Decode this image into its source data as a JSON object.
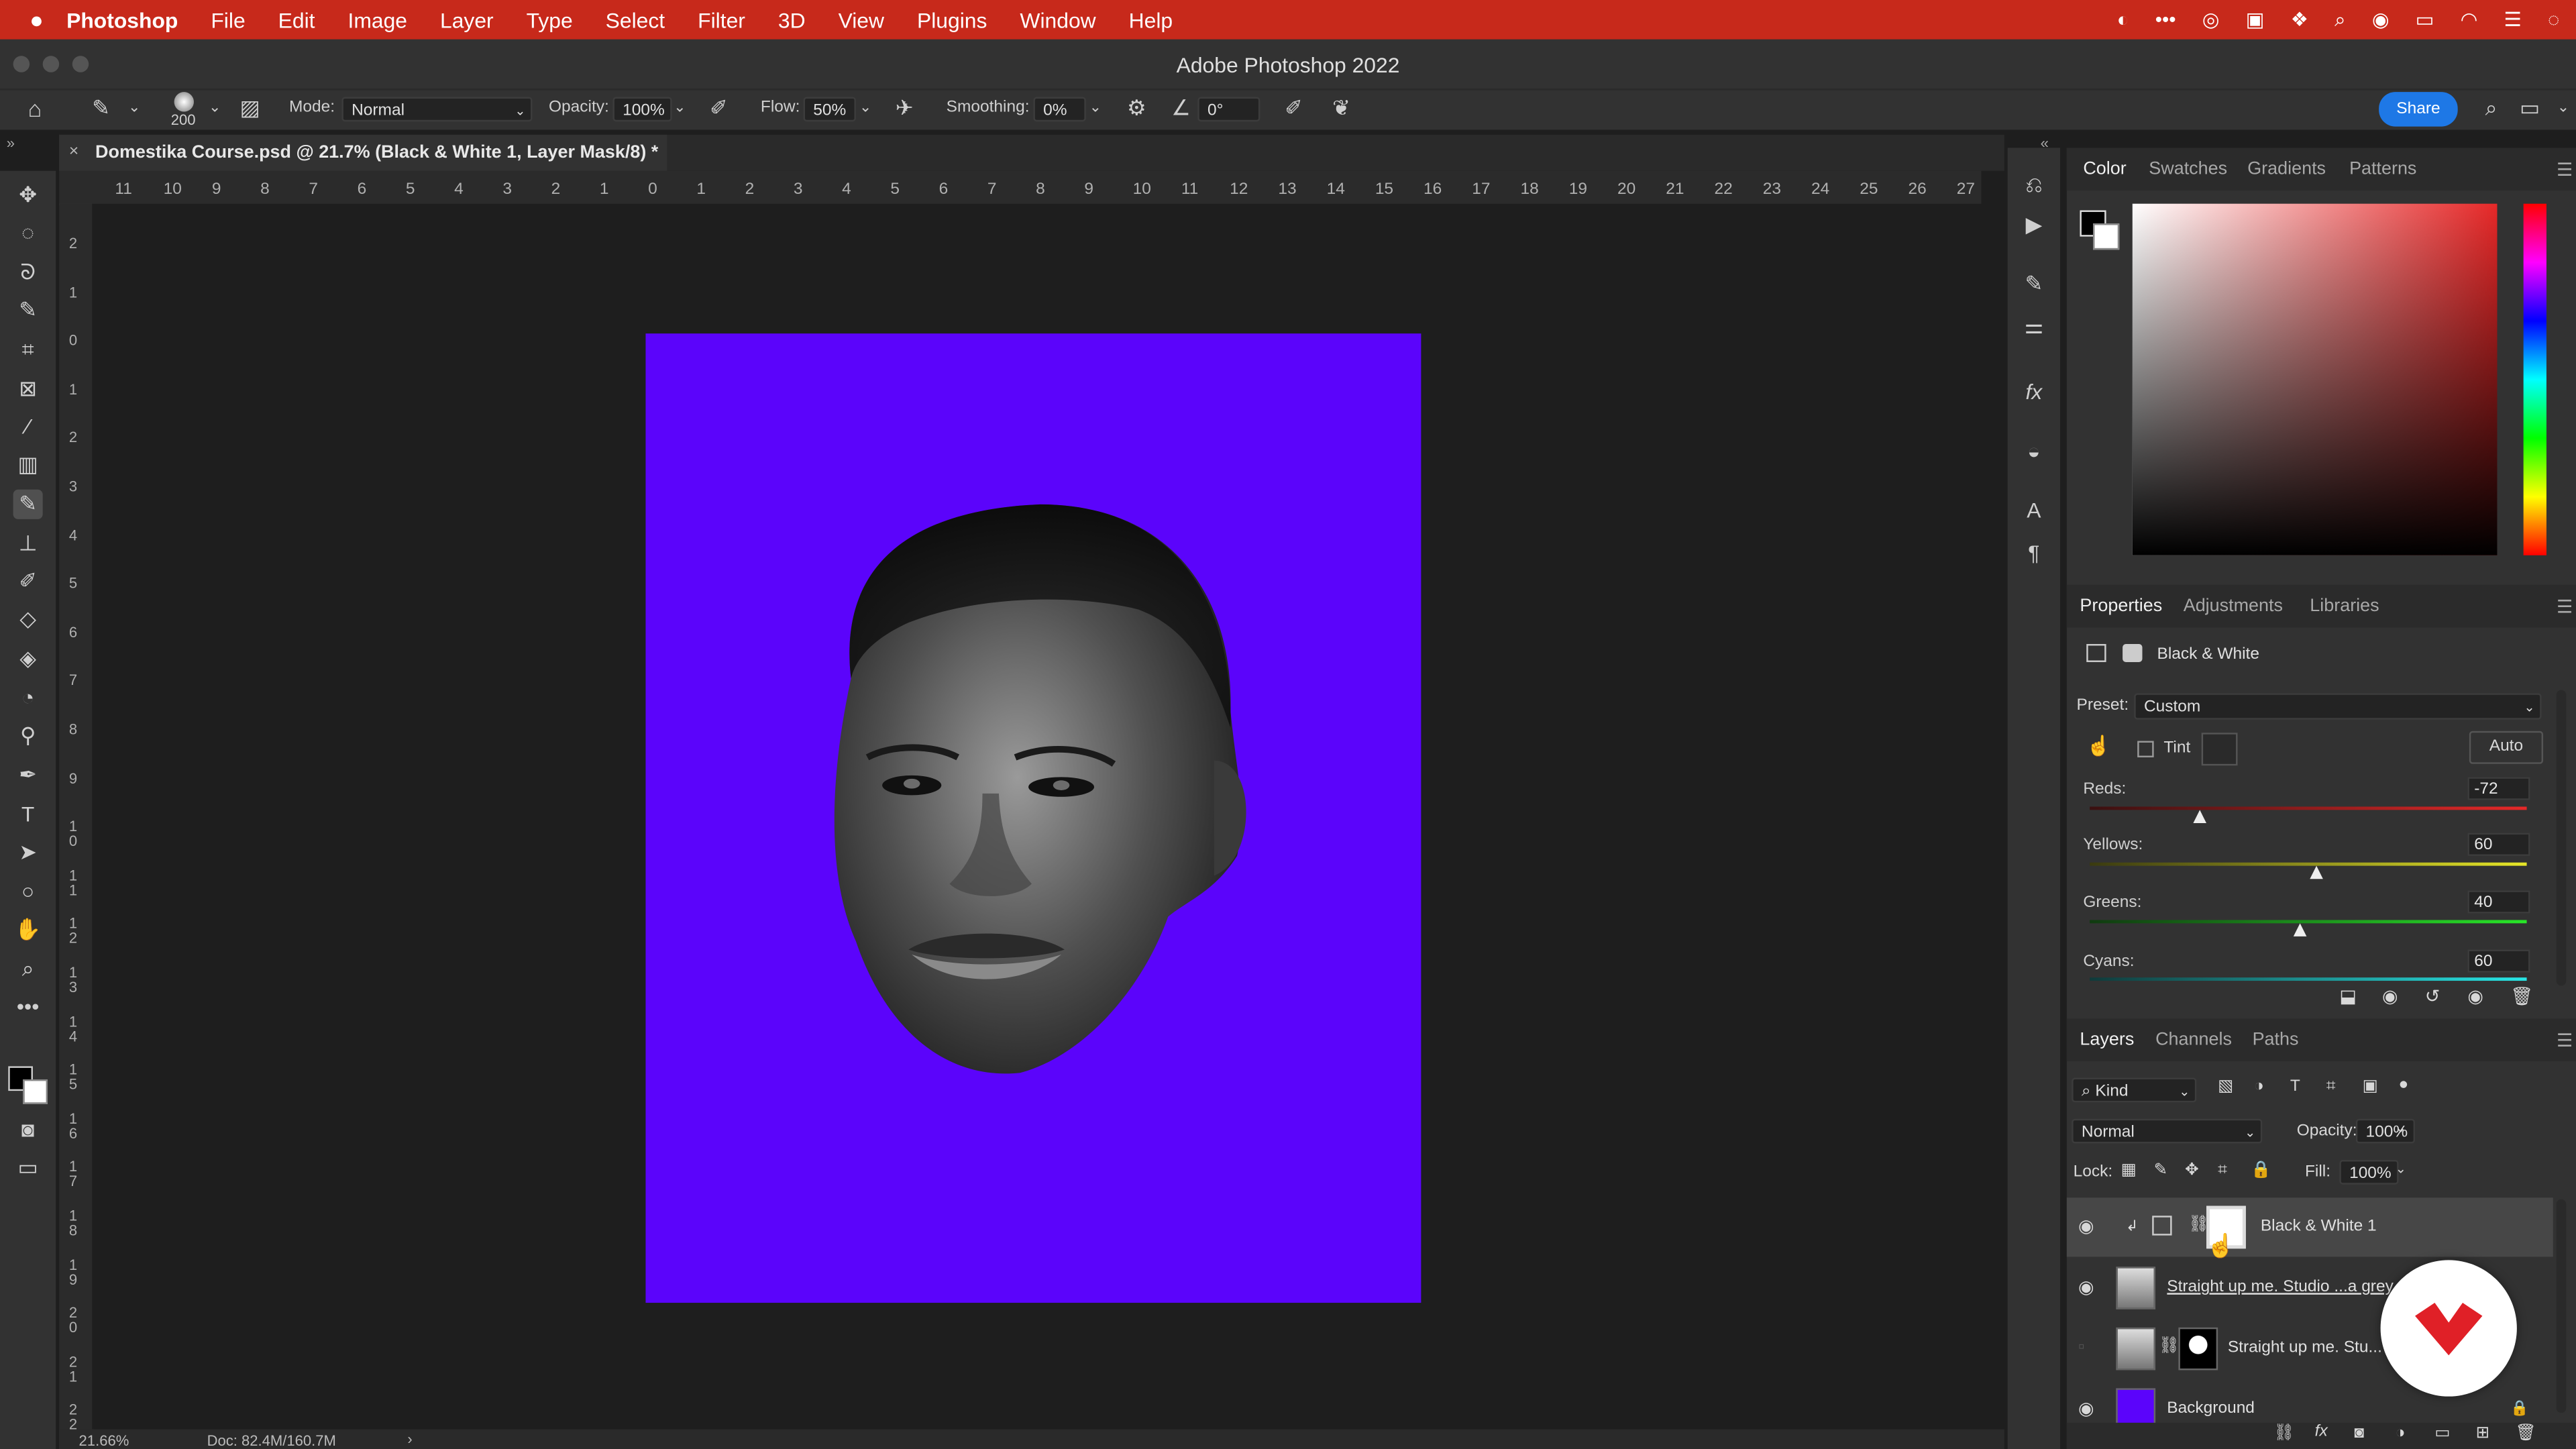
{
  "menubar": {
    "app": "Photoshop",
    "items": [
      "File",
      "Edit",
      "Image",
      "Layer",
      "Type",
      "Select",
      "Filter",
      "3D",
      "View",
      "Plugins",
      "Window",
      "Help"
    ]
  },
  "window": {
    "title": "Adobe Photoshop 2022"
  },
  "options": {
    "brush_size": "200",
    "mode_label": "Mode:",
    "mode_value": "Normal",
    "opacity_label": "Opacity:",
    "opacity_value": "100%",
    "flow_label": "Flow:",
    "flow_value": "50%",
    "smoothing_label": "Smoothing:",
    "smoothing_value": "0%",
    "angle_value": "0°",
    "share_label": "Share"
  },
  "document": {
    "tab_title": "Domestika Course.psd @ 21.7% (Black & White 1, Layer Mask/8) *",
    "canvas_color": "#5b04fb"
  },
  "rulers": {
    "h_ticks": [
      "11",
      "10",
      "9",
      "8",
      "7",
      "6",
      "5",
      "4",
      "3",
      "2",
      "1",
      "0",
      "1",
      "2",
      "3",
      "4",
      "5",
      "6",
      "7",
      "8",
      "9",
      "10",
      "11",
      "12",
      "13",
      "14",
      "15",
      "16",
      "17",
      "18",
      "19",
      "20",
      "21",
      "22",
      "23",
      "24",
      "25",
      "26",
      "27"
    ],
    "v_ticks": [
      "2",
      "1",
      "0",
      "1",
      "2",
      "3",
      "4",
      "5",
      "6",
      "7",
      "8",
      "9",
      "1\n0",
      "1\n1",
      "1\n2",
      "1\n3",
      "1\n4",
      "1\n5",
      "1\n6",
      "1\n7",
      "1\n8",
      "1\n9",
      "2\n0",
      "2\n1",
      "2\n2"
    ]
  },
  "status": {
    "zoom": "21.66%",
    "doc": "Doc: 82.4M/160.7M"
  },
  "color_panel": {
    "tabs": [
      "Color",
      "Swatches",
      "Gradients",
      "Patterns"
    ],
    "active_tab": "Color"
  },
  "properties_panel": {
    "tabs": [
      "Properties",
      "Adjustments",
      "Libraries"
    ],
    "adjustment_name": "Black & White",
    "preset_label": "Preset:",
    "preset_value": "Custom",
    "tint_label": "Tint",
    "auto_label": "Auto",
    "sliders": [
      {
        "label": "Reds:",
        "value": "-72",
        "fraction": 0.25
      },
      {
        "label": "Yellows:",
        "value": "60",
        "fraction": 0.52
      },
      {
        "label": "Greens:",
        "value": "40",
        "fraction": 0.48
      },
      {
        "label": "Cyans:",
        "value": "60",
        "fraction": 0.52
      }
    ]
  },
  "layers_panel": {
    "tabs": [
      "Layers",
      "Channels",
      "Paths"
    ],
    "kind_label": "Kind",
    "blend_mode": "Normal",
    "opacity_label": "Opacity:",
    "opacity_value": "100%",
    "lock_label": "Lock:",
    "fill_label": "Fill:",
    "fill_value": "100%",
    "layers": [
      {
        "name": "Black & White 1"
      },
      {
        "name": "Straight up me. Studio ...a grey"
      },
      {
        "name": "Straight up me. Stu..."
      },
      {
        "name": "Background"
      }
    ]
  }
}
